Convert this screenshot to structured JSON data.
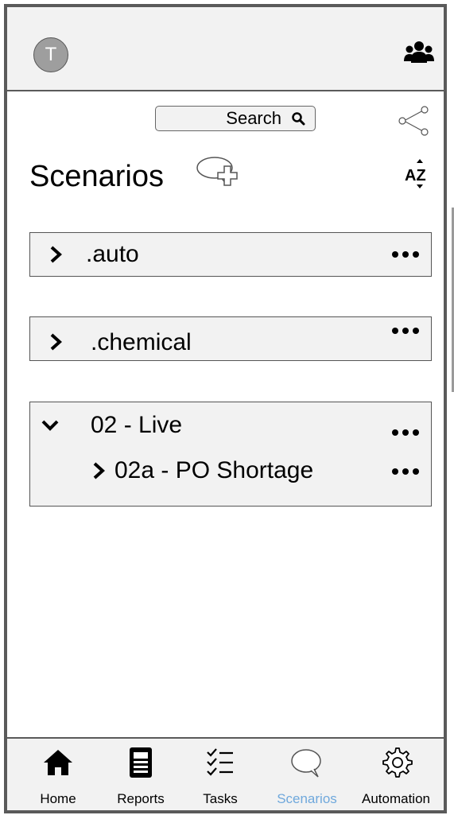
{
  "header": {
    "avatar_initial": "T"
  },
  "toolbar": {
    "search_label": "Search"
  },
  "page": {
    "title": "Scenarios"
  },
  "items": [
    {
      "label": ".auto",
      "expanded": false
    },
    {
      "label": ".chemical",
      "expanded": false
    },
    {
      "label": "02 - Live",
      "expanded": true,
      "children": [
        {
          "label": "02a - PO Shortage"
        }
      ]
    }
  ],
  "nav": {
    "home": "Home",
    "reports": "Reports",
    "tasks": "Tasks",
    "scenarios": "Scenarios",
    "automation": "Automation",
    "active": "scenarios",
    "active_color": "#6fa8dc"
  },
  "icons": [
    "users-icon",
    "search-icon",
    "share-icon",
    "add-scenario-icon",
    "sort-az-icon",
    "chevron-right-icon",
    "chevron-down-icon",
    "more-icon",
    "home-icon",
    "reports-icon",
    "tasks-icon",
    "scenarios-icon",
    "automation-icon"
  ]
}
